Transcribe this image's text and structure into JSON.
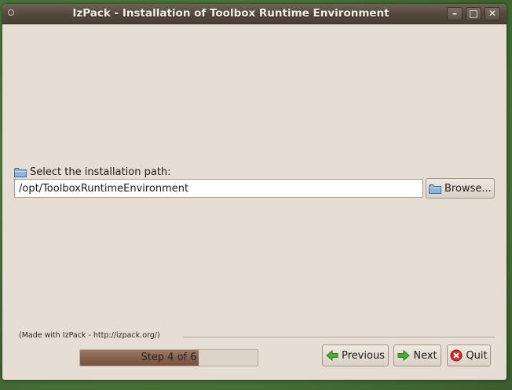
{
  "window": {
    "title": "IzPack - Installation of Toolbox Runtime Environment",
    "controls": {
      "minimize": "–",
      "maximize": "□",
      "close": "✕"
    }
  },
  "panel": {
    "path_label": "Select the installation path:",
    "path_value": "/opt/ToolboxRuntimeEnvironment",
    "browse_label": "Browse..."
  },
  "footer": {
    "made_with": "(Made with IzPack - http://izpack.org/)",
    "progress_text": "Step 4 of 6",
    "progress_fraction": 0.667,
    "previous_label": "Previous",
    "next_label": "Next",
    "quit_label": "Quit"
  },
  "icons": {
    "folder": "folder-icon",
    "previous": "arrow-left-icon",
    "next": "arrow-right-icon",
    "quit": "quit-icon"
  },
  "colors": {
    "window_bg": "#e6ddd4",
    "titlebar": "#54483d",
    "progress_fill": "#85624e",
    "arrow_green": "#3a9a2a",
    "quit_red": "#cc2222"
  }
}
